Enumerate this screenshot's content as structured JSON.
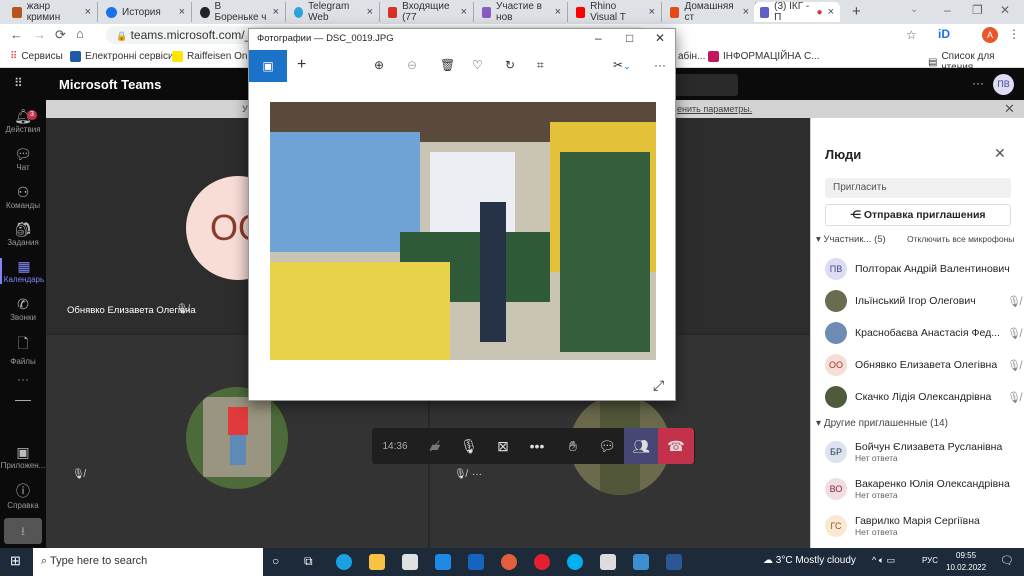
{
  "browser": {
    "tabs": [
      {
        "label": "жанр кримин",
        "color": "#b5541b"
      },
      {
        "label": "История",
        "color": "#1a73e8"
      },
      {
        "label": "В Бореньке ч",
        "color": "#222"
      },
      {
        "label": "Telegram Web",
        "color": "#2aa3df"
      },
      {
        "label": "Входящие (77",
        "color": "#d93025"
      },
      {
        "label": "Участие в нов",
        "color": "#8a5bc0"
      },
      {
        "label": "Rhino Visual T",
        "color": "#ff0000"
      },
      {
        "label": "Домашняя ст",
        "color": "#e64a19"
      },
      {
        "label": "(3) ІКГ - П",
        "color": "#5b5fc7"
      }
    ],
    "url": "teams.microsoft.com/_#/pre-join",
    "bookmarks": [
      "Сервисы",
      "Електронні сервіси...",
      "Raiffeisen Online",
      "абін...",
      "ІНФОРМАЦІЙНА С..."
    ],
    "reading_list": "Список для чтения",
    "profile": "A"
  },
  "teams": {
    "title": "Microsoft Teams",
    "user_initials": "ПВ",
    "rail": [
      {
        "label": "Действия",
        "icon": "bell-icon",
        "badge": "3"
      },
      {
        "label": "Чат",
        "icon": "chat-icon"
      },
      {
        "label": "Команды",
        "icon": "teams-icon"
      },
      {
        "label": "Задания",
        "icon": "assignments-icon"
      },
      {
        "label": "Календарь",
        "icon": "calendar-icon"
      },
      {
        "label": "Звонки",
        "icon": "calls-icon"
      },
      {
        "label": "Файлы",
        "icon": "files-icon"
      },
      {
        "label": "Приложен...",
        "icon": "apps-icon"
      },
      {
        "label": "Справка",
        "icon": "help-icon"
      }
    ],
    "banner_start": "У",
    "banner_link": "енить параметры.",
    "tile1": {
      "initials": "OO",
      "name": "Обнявко Елизавета Олегівна"
    },
    "call": {
      "timer": "14:36"
    },
    "people": {
      "title": "Люди",
      "invite_placeholder": "Пригласить",
      "share_invite": "Отправка приглашения",
      "participants_label": "Участник...",
      "participants_count": "(5)",
      "mute_all": "Отключить все микрофоны",
      "participants": [
        {
          "initials": "ПВ",
          "name": "Полторак Андрій Валентинович",
          "bg": "#dcdcf2",
          "fg": "#444791"
        },
        {
          "initials": "",
          "name": "Ільїнський Ігор Олегович",
          "bg": "#6b6b50"
        },
        {
          "initials": "",
          "name": "Краснобаєва Анастасія Фед...",
          "bg": "#6e8bb5"
        },
        {
          "initials": "ОО",
          "name": "Обнявко Елизавета Олегівна",
          "bg": "#f7dcd8",
          "fg": "#9a3b2e"
        },
        {
          "initials": "",
          "name": "Скачко Лідія Олександрівна",
          "bg": "#4e5a3a"
        }
      ],
      "others_label": "Другие приглашенные",
      "others_count": "(14)",
      "others": [
        {
          "initials": "БР",
          "name": "Бойчун Єлизавета Русланівна",
          "status": "Нет ответа",
          "bg": "#dbe4ee",
          "fg": "#335"
        },
        {
          "initials": "ВО",
          "name": "Вакаренко Юлія Олександрівна",
          "status": "Нет ответа",
          "bg": "#f0dde2",
          "fg": "#7a2a3a"
        },
        {
          "initials": "ГС",
          "name": "Гаврилко Марія Сергіївна",
          "status": "Нет ответа",
          "bg": "#fbe8d3",
          "fg": "#8a5a1a"
        }
      ]
    }
  },
  "photos": {
    "title": "Фотографии — DSC_0019.JPG"
  },
  "taskbar": {
    "search_placeholder": "Type here to search",
    "weather": "3°C  Mostly cloudy",
    "lang": "РУС",
    "time": "09:55",
    "date": "10.02.2022"
  }
}
